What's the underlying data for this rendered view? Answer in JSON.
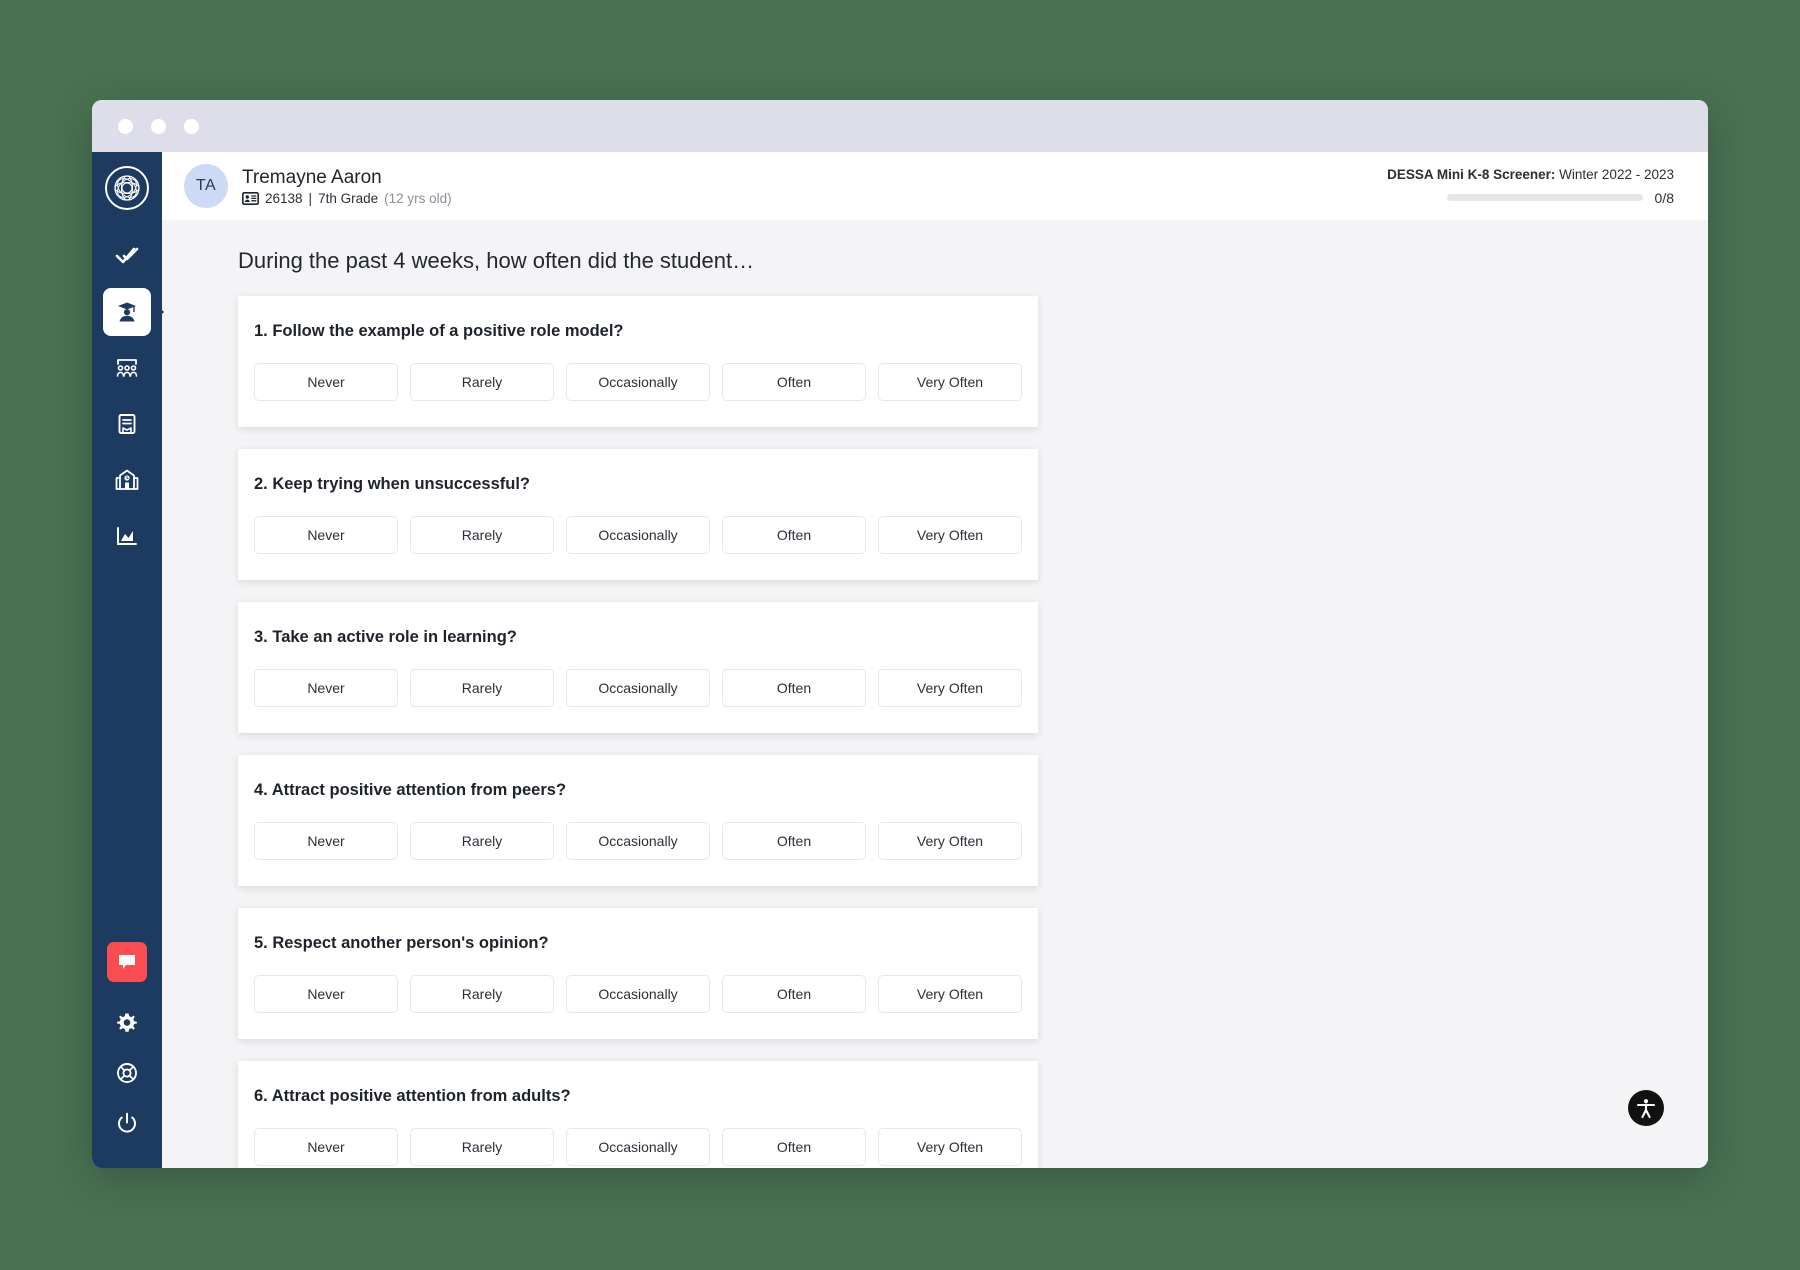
{
  "window": {
    "traffic_dots": [
      "close",
      "minimize",
      "maximize"
    ]
  },
  "sidebar": {
    "logo_name": "globe-logo",
    "items": [
      {
        "name": "tasks",
        "icon": "double-check-icon",
        "active": false
      },
      {
        "name": "students",
        "icon": "graduate-icon",
        "active": true
      },
      {
        "name": "classrooms",
        "icon": "classroom-group-icon",
        "active": false
      },
      {
        "name": "resources",
        "icon": "book-icon",
        "active": false
      },
      {
        "name": "schools",
        "icon": "school-clock-icon",
        "active": false
      },
      {
        "name": "reports",
        "icon": "area-chart-icon",
        "active": false
      }
    ],
    "bottom_items": [
      {
        "name": "messages",
        "icon": "chat-bubble-icon"
      },
      {
        "name": "settings",
        "icon": "gear-icon"
      },
      {
        "name": "help",
        "icon": "life-ring-icon"
      },
      {
        "name": "logout",
        "icon": "power-icon"
      }
    ],
    "accent_red": "#f94d52",
    "background": "#1d3a60"
  },
  "header": {
    "avatar_initials": "TA",
    "student_name": "Tremayne Aaron",
    "student_id": "26138",
    "separator": "|",
    "grade": "7th Grade",
    "age": "(12 yrs old)",
    "screener_label": "DESSA Mini K-8 Screener:",
    "screener_term": "Winter 2022 - 2023",
    "progress_text": "0/8",
    "progress_percent": 0
  },
  "main": {
    "page_title": "During the past 4 weeks, how often did the student…",
    "options": [
      "Never",
      "Rarely",
      "Occasionally",
      "Often",
      "Very Often"
    ],
    "questions": [
      {
        "number": "1.",
        "text": "Follow the example of a positive role model?"
      },
      {
        "number": "2.",
        "text": "Keep trying when unsuccessful?"
      },
      {
        "number": "3.",
        "text": "Take an active role in learning?"
      },
      {
        "number": "4.",
        "text": "Attract positive attention from peers?"
      },
      {
        "number": "5.",
        "text": "Respect another person's opinion?"
      },
      {
        "number": "6.",
        "text": "Attract positive attention from adults?"
      }
    ]
  },
  "accessibility": {
    "button_name": "accessibility-icon"
  }
}
